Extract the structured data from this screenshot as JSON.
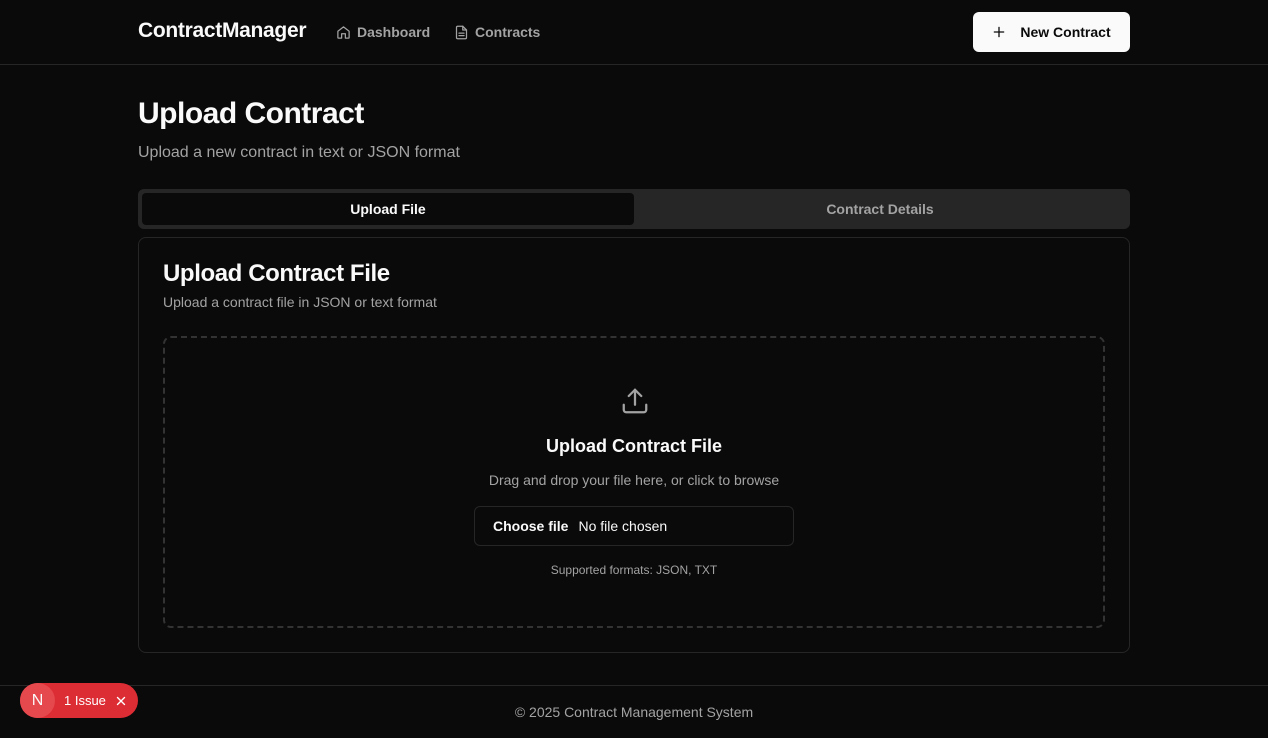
{
  "header": {
    "brand": "ContractManager",
    "nav": [
      {
        "label": "Dashboard",
        "icon": "home-icon"
      },
      {
        "label": "Contracts",
        "icon": "file-text-icon"
      }
    ],
    "new_button_label": "New Contract",
    "new_button_icon": "plus-icon"
  },
  "page": {
    "title": "Upload Contract",
    "subtitle": "Upload a new contract in text or JSON format"
  },
  "tabs": [
    {
      "label": "Upload File",
      "active": true
    },
    {
      "label": "Contract Details",
      "active": false
    }
  ],
  "card": {
    "title": "Upload Contract File",
    "description": "Upload a contract file in JSON or text format",
    "dropzone": {
      "icon": "upload-icon",
      "title": "Upload Contract File",
      "description": "Drag and drop your file here, or click to browse",
      "choose_label": "Choose file",
      "file_status": "No file chosen",
      "formats": "Supported formats: JSON, TXT"
    }
  },
  "footer": {
    "text": "© 2025 Contract Management System"
  },
  "issue_badge": {
    "avatar": "N",
    "label": "1 Issue"
  },
  "colors": {
    "background": "#0a0a0a",
    "border": "#262626",
    "muted_text": "#a3a3a3",
    "issue_red": "#dc2c34"
  }
}
